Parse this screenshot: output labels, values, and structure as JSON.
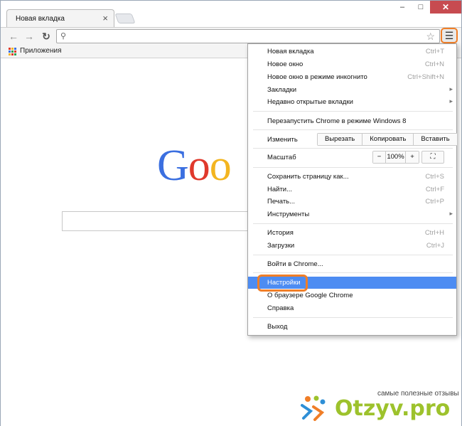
{
  "browser": {
    "tab_title": "Новая вкладка",
    "tab_close": "×",
    "window_controls": {
      "minimize": "–",
      "maximize": "□",
      "close": "✕"
    },
    "bookmarks_bar": {
      "apps_label": "Приложения"
    },
    "omnibox": {
      "value": ""
    }
  },
  "page": {
    "logo": [
      "G",
      "o",
      "o"
    ],
    "logo_colors": [
      "#3b6fe0",
      "#e0392c",
      "#f3b520"
    ]
  },
  "menu": {
    "new_tab": {
      "label": "Новая вкладка",
      "shortcut": "Ctrl+T"
    },
    "new_window": {
      "label": "Новое окно",
      "shortcut": "Ctrl+N"
    },
    "incognito": {
      "label": "Новое окно в режиме инкогнито",
      "shortcut": "Ctrl+Shift+N"
    },
    "bookmarks": {
      "label": "Закладки"
    },
    "recent_tabs": {
      "label": "Недавно открытые вкладки"
    },
    "relaunch": {
      "label": "Перезапустить Chrome в режиме Windows 8"
    },
    "edit": {
      "label": "Изменить",
      "cut": "Вырезать",
      "copy": "Копировать",
      "paste": "Вставить"
    },
    "zoom": {
      "label": "Масштаб",
      "minus": "−",
      "value": "100%",
      "plus": "+",
      "fullscreen": "⛶"
    },
    "save_page": {
      "label": "Сохранить страницу как...",
      "shortcut": "Ctrl+S"
    },
    "find": {
      "label": "Найти...",
      "shortcut": "Ctrl+F"
    },
    "print": {
      "label": "Печать...",
      "shortcut": "Ctrl+P"
    },
    "tools": {
      "label": "Инструменты"
    },
    "history": {
      "label": "История",
      "shortcut": "Ctrl+H"
    },
    "downloads": {
      "label": "Загрузки",
      "shortcut": "Ctrl+J"
    },
    "signin": {
      "label": "Войти в Chrome..."
    },
    "settings": {
      "label": "Настройки"
    },
    "about": {
      "label": "О браузере Google Chrome"
    },
    "help": {
      "label": "Справка"
    },
    "exit": {
      "label": "Выход"
    },
    "submenu_arrow": "▸"
  },
  "watermark": {
    "tagline": "самые полезные отзывы",
    "brand": "Otzyv.pro"
  },
  "colors": {
    "highlight": "#f07e27",
    "active_item": "#4d8cf2"
  }
}
